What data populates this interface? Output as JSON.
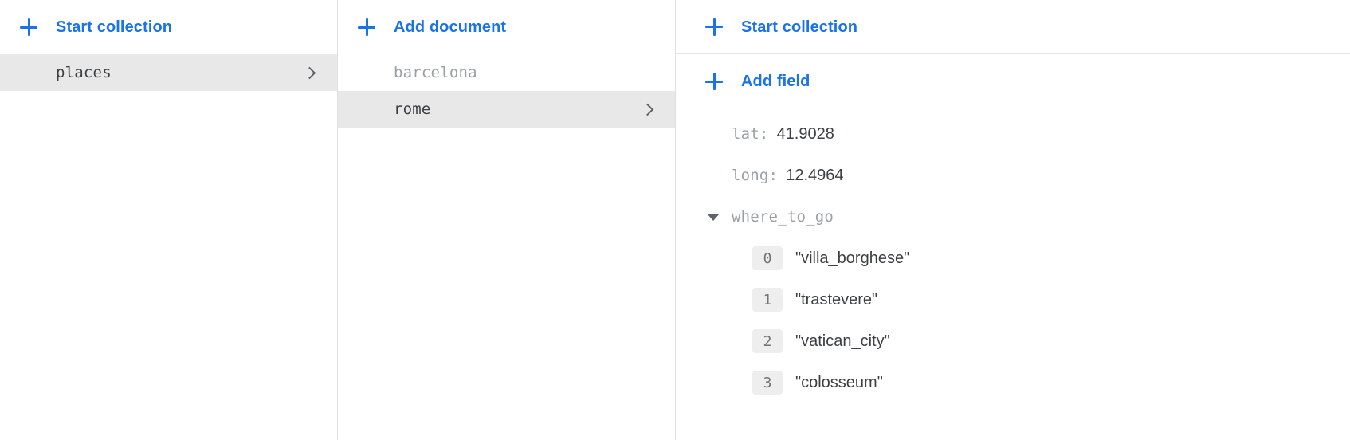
{
  "colors": {
    "accent": "#1a73e8",
    "selected_row_bg": "#e8e8e8",
    "index_badge_bg": "#eeeeee",
    "text_primary": "#3c4043",
    "text_muted": "#9aa0a6",
    "divider": "#e0e0e0"
  },
  "collections_panel": {
    "action": {
      "label": "Start collection",
      "icon": "plus-icon"
    },
    "items": [
      {
        "name": "places",
        "selected": true,
        "muted": false,
        "chevron": "chevron-right-icon"
      }
    ]
  },
  "documents_panel": {
    "action": {
      "label": "Add document",
      "icon": "plus-icon"
    },
    "items": [
      {
        "name": "barcelona",
        "selected": false,
        "muted": true,
        "chevron": null
      },
      {
        "name": "rome",
        "selected": true,
        "muted": false,
        "chevron": "chevron-right-icon"
      }
    ]
  },
  "fields_panel": {
    "actions": [
      {
        "label": "Start collection",
        "icon": "plus-icon"
      },
      {
        "label": "Add field",
        "icon": "plus-icon"
      }
    ],
    "fields": [
      {
        "key": "lat:",
        "value": "41.9028",
        "expandable": false
      },
      {
        "key": "long:",
        "value": "12.4964",
        "expandable": false
      },
      {
        "key": "where_to_go",
        "value": "",
        "expandable": true,
        "expanded": true,
        "children": [
          {
            "index": "0",
            "value": "\"villa_borghese\""
          },
          {
            "index": "1",
            "value": "\"trastevere\""
          },
          {
            "index": "2",
            "value": "\"vatican_city\""
          },
          {
            "index": "3",
            "value": "\"colosseum\""
          }
        ]
      }
    ]
  }
}
